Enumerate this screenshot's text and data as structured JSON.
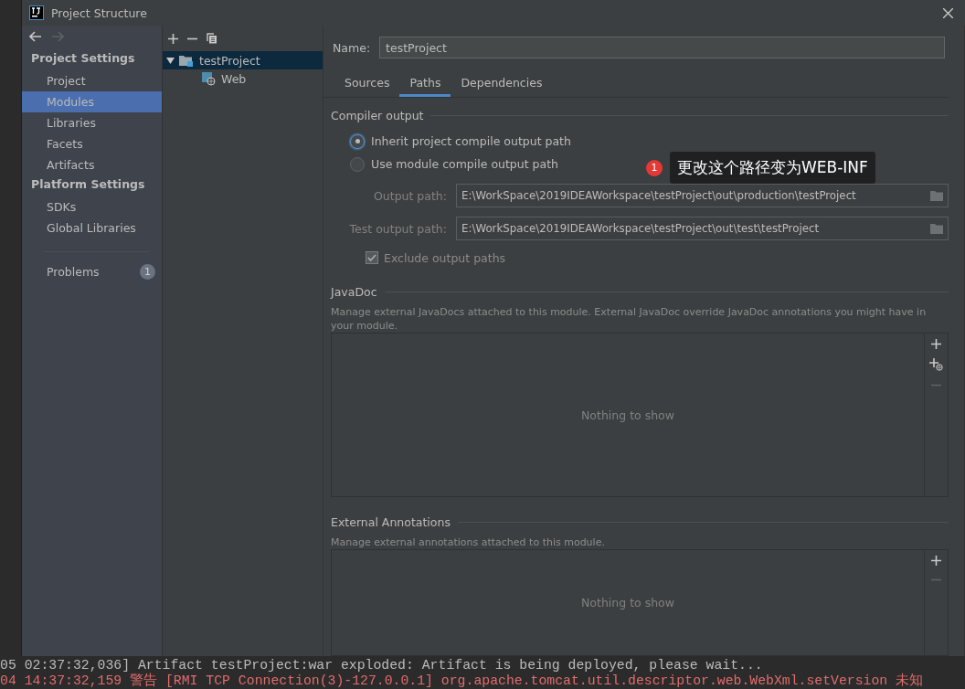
{
  "window": {
    "title": "Project Structure"
  },
  "nav": {
    "sections": [
      {
        "title": "Project Settings",
        "items": [
          {
            "label": "Project",
            "selected": false
          },
          {
            "label": "Modules",
            "selected": true
          },
          {
            "label": "Libraries",
            "selected": false
          },
          {
            "label": "Facets",
            "selected": false
          },
          {
            "label": "Artifacts",
            "selected": false
          }
        ]
      },
      {
        "title": "Platform Settings",
        "items": [
          {
            "label": "SDKs",
            "selected": false
          },
          {
            "label": "Global Libraries",
            "selected": false
          }
        ]
      }
    ],
    "problems": {
      "label": "Problems",
      "count": "1"
    }
  },
  "tree": {
    "items": [
      {
        "label": "testProject",
        "kind": "module",
        "expanded": true,
        "selected": true,
        "children": [
          {
            "label": "Web",
            "kind": "facet",
            "selected": false
          }
        ]
      }
    ]
  },
  "name_field": {
    "label": "Name:",
    "value": "testProject"
  },
  "tabs": [
    {
      "label": "Sources",
      "selected": false
    },
    {
      "label": "Paths",
      "selected": true
    },
    {
      "label": "Dependencies",
      "selected": false
    }
  ],
  "compiler_output": {
    "title": "Compiler output",
    "options": [
      {
        "label": "Inherit project compile output path",
        "selected": true
      },
      {
        "label": "Use module compile output path",
        "selected": false
      }
    ],
    "paths": [
      {
        "label": "Output path:",
        "value": "E:\\WorkSpace\\2019IDEAWorkspace\\testProject\\out\\production\\testProject",
        "disabled": true
      },
      {
        "label": "Test output path:",
        "value": "E:\\WorkSpace\\2019IDEAWorkspace\\testProject\\out\\test\\testProject",
        "disabled": true
      }
    ],
    "exclude": {
      "label": "Exclude output paths",
      "checked": true,
      "disabled": true
    }
  },
  "javadoc": {
    "title": "JavaDoc",
    "description": "Manage external JavaDocs attached to this module. External JavaDoc override JavaDoc annotations you might have in your module.",
    "empty_text": "Nothing to show",
    "tools": [
      {
        "kind": "add",
        "disabled": false
      },
      {
        "kind": "add-url",
        "disabled": false
      },
      {
        "kind": "remove",
        "disabled": true
      }
    ]
  },
  "external_annotations": {
    "title": "External Annotations",
    "description": "Manage external annotations attached to this module.",
    "empty_text": "Nothing to show",
    "tools": [
      {
        "kind": "add",
        "disabled": false
      },
      {
        "kind": "remove",
        "disabled": true
      }
    ]
  },
  "annotation": {
    "badge": "1",
    "text": "更改这个路径变为WEB-INF"
  },
  "console": {
    "lines": [
      {
        "text": "05 02:37:32,036] Artifact testProject:war exploded: Artifact is being deployed, please wait...",
        "kind": "info"
      },
      {
        "text": "04 14:37:32,159 警告 [RMI TCP Connection(3)-127.0.0.1] org.apache.tomcat.util.descriptor.web.WebXml.setVersion 未知",
        "kind": "warning"
      }
    ]
  }
}
